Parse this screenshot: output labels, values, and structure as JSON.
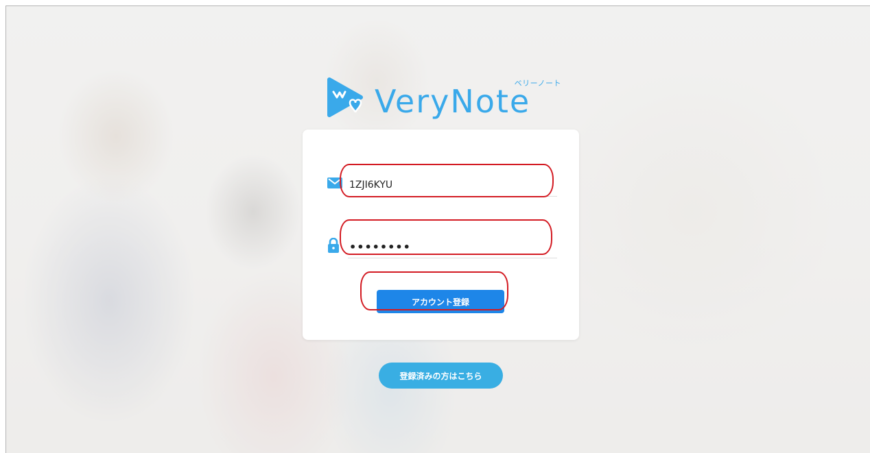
{
  "logo": {
    "text": "VeryNote",
    "kana": "ベリーノート"
  },
  "form": {
    "email_value": "1ZJI6KYU",
    "password_value": "••••••••",
    "submit_label": "アカウント登録"
  },
  "footer": {
    "login_link_label": "登録済みの方はこちら"
  },
  "icons": {
    "email": "mail-icon",
    "password": "lock-icon",
    "brand": "verynote-logo-icon"
  },
  "colors": {
    "brand": "#3aa9ea",
    "primary_button": "#1e86e8",
    "secondary_button": "#39aee3",
    "annotation": "#d31a22"
  }
}
